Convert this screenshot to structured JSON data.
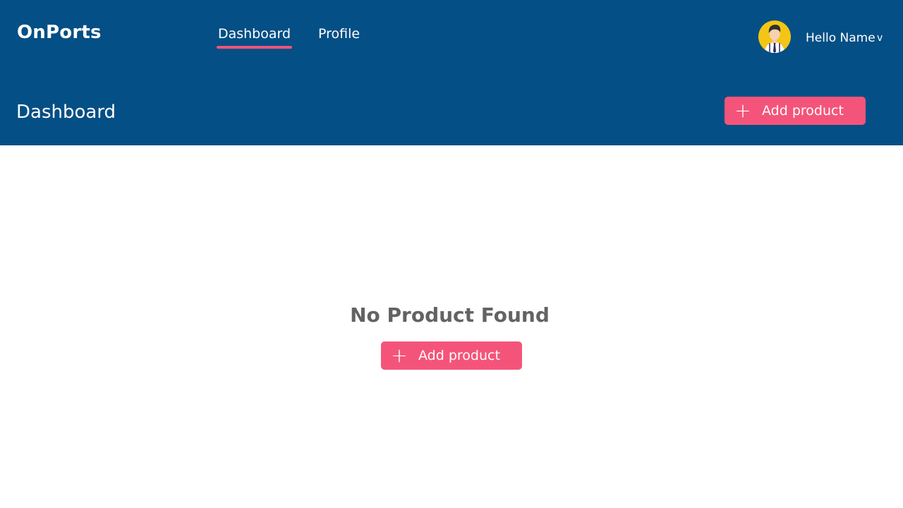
{
  "app": {
    "brand": "OnPorts"
  },
  "nav": {
    "tabs": [
      {
        "label": "Dashboard",
        "active": true
      },
      {
        "label": "Profile",
        "active": false
      }
    ]
  },
  "user": {
    "greeting": "Hello Name",
    "dropdown_icon": "chevron-down-icon",
    "avatar_icon": "user-avatar-icon"
  },
  "page": {
    "title": "Dashboard"
  },
  "header_action": {
    "label": "Add product",
    "icon": "plus-icon"
  },
  "empty_state": {
    "message": "No Product Found",
    "action_label": "Add product",
    "action_icon": "plus-icon"
  },
  "colors": {
    "header_bg": "#044f85",
    "accent": "#f5547a",
    "empty_text": "#636363",
    "avatar_bg": "#f4c514"
  }
}
